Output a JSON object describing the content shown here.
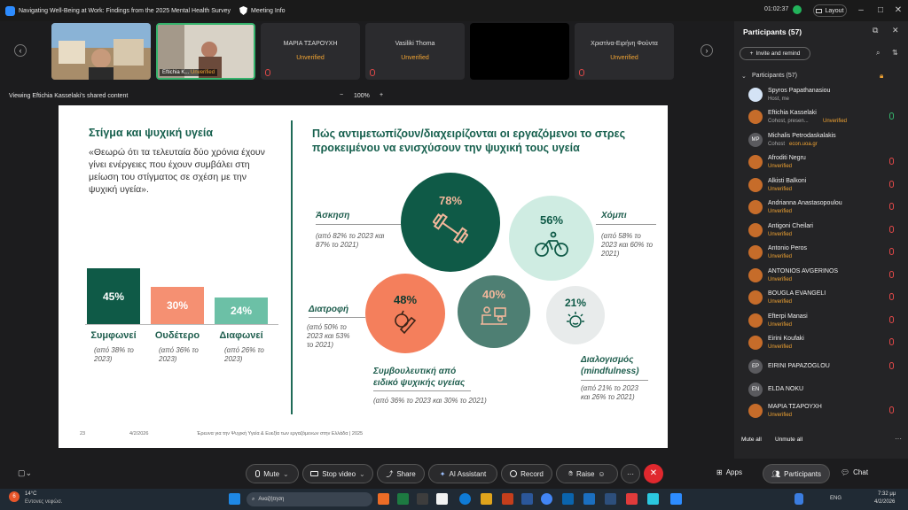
{
  "titlebar": {
    "meeting_title": "Navigating Well-Being at Work: Findings from the 2025 Mental Health Survey",
    "meeting_info": "Meeting Info",
    "timer": "01:02:37",
    "layout_label": "Layout"
  },
  "gallery": {
    "tiles": [
      {
        "name": "",
        "video": true
      },
      {
        "name": "Eftichia K...",
        "status": "Unverified",
        "video": true
      },
      {
        "name": "ΜΑΡΙΑ ΤΣΑΡΟΥΧΗ",
        "status": "Unverified"
      },
      {
        "name": "Vasiliki Thoma",
        "status": "Unverified"
      },
      {
        "name": "",
        "status": ""
      },
      {
        "name": "Χριστίνα-Ειρήνη Φούντα",
        "status": "Unverified"
      }
    ]
  },
  "viewbar": {
    "label": "Viewing Eftichia Kasselaki's shared content",
    "zoom": "100%",
    "minus": "−",
    "plus": "+"
  },
  "slide": {
    "title_left": "Στίγμα και ψυχική υγεία",
    "quote": "«Θεωρώ ότι τα τελευταία δύο χρόνια έχουν γίνει ενέργειες που έχουν συμβάλει στη μείωση του στίγματος σε σχέση με την ψυχική υγεία».",
    "title_right": "Πώς αντιμετωπίζουν/διαχειρίζονται οι εργαζόμενοι το στρες προκειμένου να ενισχύσουν την ψυχική τους υγεία",
    "bars": [
      {
        "pct": "45%",
        "value": 45,
        "label": "Συμφωνεί",
        "sub": "(από 38% το 2023)",
        "color": "#0f5a47"
      },
      {
        "pct": "30%",
        "value": 30,
        "label": "Ουδέτερο",
        "sub": "(από 36% το 2023)",
        "color": "#f59072"
      },
      {
        "pct": "24%",
        "value": 24,
        "label": "Διαφωνεί",
        "sub": "(από 26% το 2023)",
        "color": "#6cc0a6"
      }
    ],
    "bubbles": {
      "exercise": {
        "pct": "78%",
        "label": "Άσκηση",
        "sub": "(από 82% το 2023 και 87% το 2021)",
        "color": "#0f5a47",
        "icon": "dumbbell-icon"
      },
      "hobby": {
        "pct": "56%",
        "label": "Χόμπι",
        "sub": "(από 58% το 2023 και 60% το 2021)",
        "color": "#cfece2",
        "icon": "bicycle-icon"
      },
      "diet": {
        "pct": "48%",
        "label": "Διατροφή",
        "sub": "(από 50% το 2023 και 53% το 2021)",
        "color": "#f47f5c",
        "icon": "food-icon"
      },
      "counseling": {
        "pct": "40%",
        "label": "Συμβουλευτική από ειδικό ψυχικής υγείας",
        "sub": "(από 36% το 2023 και 30% το 2021)",
        "color": "#4e7f73",
        "icon": "therapy-icon"
      },
      "mindfulness": {
        "pct": "21%",
        "label": "Διαλογισμός (mindfulness)",
        "sub": "(από 21% το 2023 και 26% το 2021)",
        "color": "#e8ebeb",
        "icon": "sun-face-icon"
      }
    },
    "footer_page": "23",
    "footer_date": "4/2/2026",
    "footer_text": "Έρευνα για την Ψυχική Υγεία & Ευεξία των εργαζόμενων στην Ελλάδα | 2025"
  },
  "panel": {
    "header": "Participants (57)",
    "invite": "Invite and remind",
    "subheader": "Participants (57)",
    "participants": [
      {
        "name": "Spyros Papathanasiou",
        "sub": "Host, me",
        "initials": "",
        "photo": true
      },
      {
        "name": "Eftichia Kasselaki",
        "sub": "Cohost, presen...",
        "status": "Unverified"
      },
      {
        "name": "Michalis Petrodaskalakis",
        "sub": "Cohost",
        "status": "econ.uoa.gr",
        "initials": "MP"
      },
      {
        "name": "Afroditi Negru",
        "status": "Unverified"
      },
      {
        "name": "Alkisti Balkoni",
        "status": "Unverified"
      },
      {
        "name": "Andrianna Anastasopoulou",
        "status": "Unverified"
      },
      {
        "name": "Antigoni Cheilari",
        "status": "Unverified"
      },
      {
        "name": "Antonio Peros",
        "status": "Unverified"
      },
      {
        "name": "ANTONIOS AVGERINOS",
        "status": "Unverified"
      },
      {
        "name": "BOUGLA EVANGELI",
        "status": "Unverified"
      },
      {
        "name": "Efterpi Manasi",
        "status": "Unverified"
      },
      {
        "name": "Eirini Koufaki",
        "status": "Unverified"
      },
      {
        "name": "EIRINI PAPAZOGLOU",
        "initials": "EP"
      },
      {
        "name": "ELDA NOKU",
        "initials": "EN"
      },
      {
        "name": "ΜΑΡΙΑ ΤΣΑΡΟΥΧΗ",
        "status": "Unverified"
      }
    ],
    "mute_all": "Mute all",
    "unmute_all": "Unmute all"
  },
  "toolbar": {
    "mute": "Mute",
    "stop_video": "Stop video",
    "share": "Share",
    "ai_assistant": "AI Assistant",
    "record": "Record",
    "raise": "Raise",
    "more": "···",
    "apps": "Apps",
    "participants": "Participants",
    "chat": "Chat"
  },
  "taskbar": {
    "weather_temp": "14°C",
    "weather_desc": "Εντονες νεφώσ.",
    "weather_badge": "6",
    "search_placeholder": "Αναζήτηση",
    "lang": "ENG",
    "time": "7:32 μμ",
    "date": "4/2/2026"
  }
}
